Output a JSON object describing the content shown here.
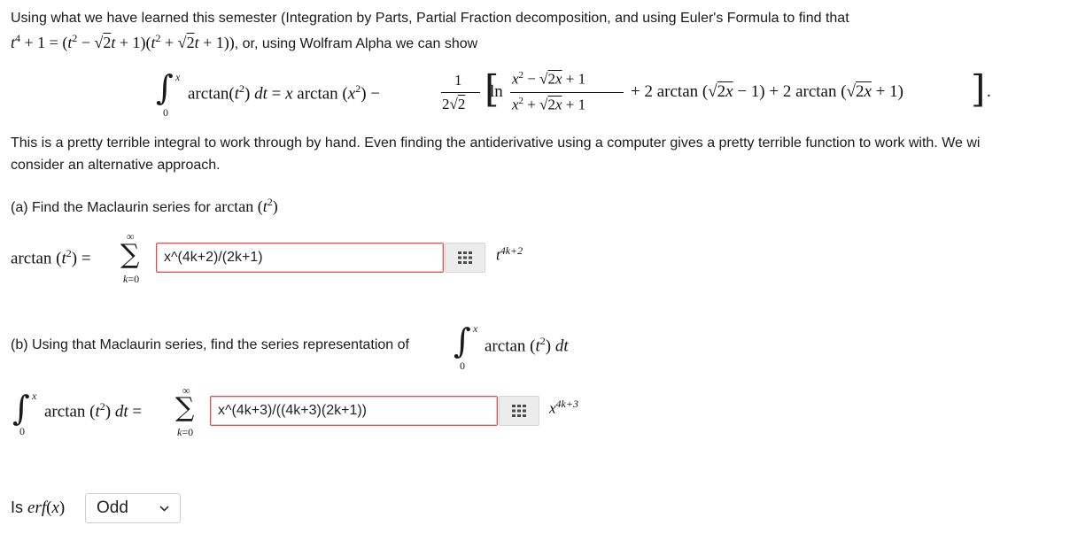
{
  "intro": {
    "line1": "Using what we have learned this semester (Integration by Parts, Partial Fraction decomposition, and using Euler's Formula to find that",
    "line2_suffix": ", or, using Wolfram Alpha we can show"
  },
  "paragraph": {
    "line1": "This is a pretty terrible integral to work through by hand. Even finding the antiderivative using a computer gives a pretty terrible function to work with. We wi",
    "line2": "consider an alternative approach."
  },
  "part_a": {
    "prompt": "(a) Find the Maclaurin series for",
    "answer": "x^(4k+2)/(2k+1)",
    "power_label": "t",
    "power_exp": "4k+2"
  },
  "part_b": {
    "prompt": "(b) Using that Maclaurin series, find the series representation of",
    "answer": "x^(4k+3)/((4k+3)(2k+1))",
    "power_label": "x",
    "power_exp": "4k+3"
  },
  "part_c": {
    "prompt": "Is",
    "selected": "Odd"
  },
  "colors": {
    "error_border": "#d9534f",
    "grid_icon": "#4a4a4a"
  }
}
